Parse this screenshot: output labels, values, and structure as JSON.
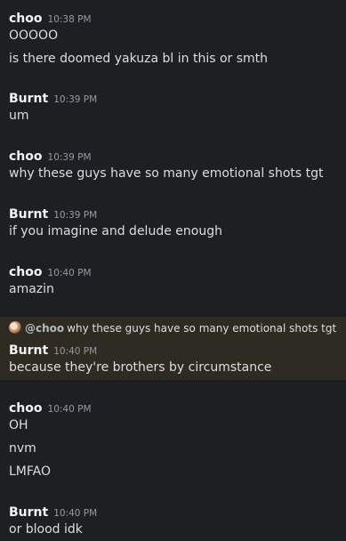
{
  "messages": [
    {
      "author": "choo",
      "time": "10:38 PM",
      "lines": [
        "OOOOO",
        "is there doomed yakuza bl in this or smth"
      ]
    },
    {
      "author": "Burnt",
      "time": "10:39 PM",
      "lines": [
        "um"
      ]
    },
    {
      "author": "choo",
      "time": "10:39 PM",
      "lines": [
        "why these guys have so many emotional shots tgt"
      ]
    },
    {
      "author": "Burnt",
      "time": "10:39 PM",
      "lines": [
        "if you imagine and delude enough"
      ]
    },
    {
      "author": "choo",
      "time": "10:40 PM",
      "lines": [
        "amazin"
      ]
    },
    {
      "author": "Burnt",
      "time": "10:40 PM",
      "lines": [
        "because they're brothers by circumstance"
      ],
      "reply_to": {
        "mention": "@choo",
        "text": "why these guys have so many emotional shots tgt"
      }
    },
    {
      "author": "choo",
      "time": "10:40 PM",
      "lines": [
        "OH",
        "nvm",
        "LMFAO"
      ]
    },
    {
      "author": "Burnt",
      "time": "10:40 PM",
      "lines": [
        "or blood idk"
      ]
    }
  ]
}
